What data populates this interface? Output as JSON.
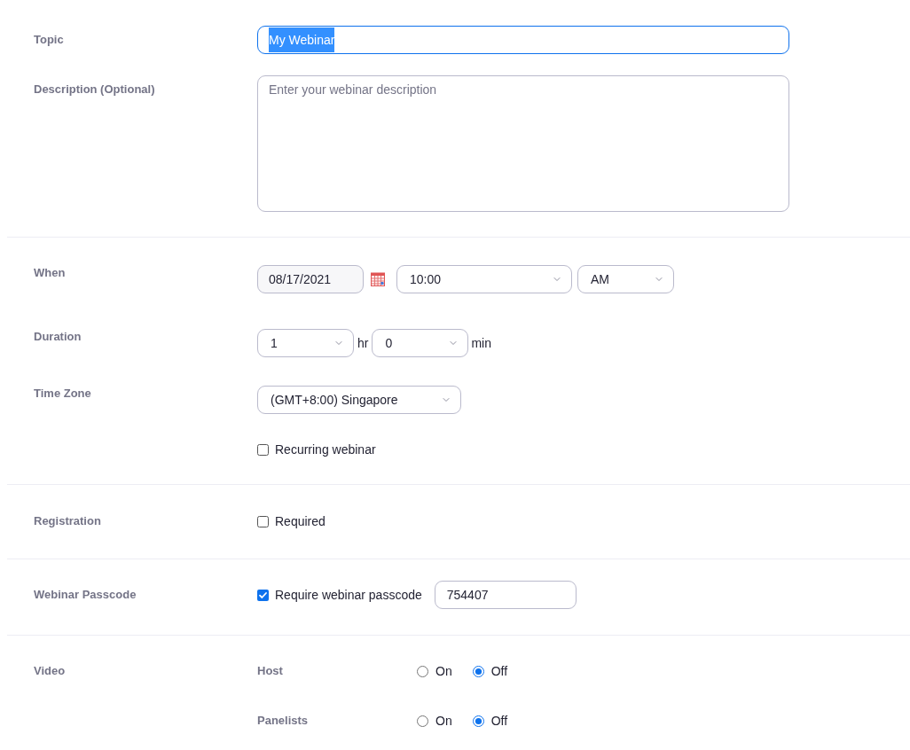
{
  "topic": {
    "label": "Topic",
    "value": "My Webinar",
    "focused": true,
    "text_selected": true
  },
  "description": {
    "label": "Description (Optional)",
    "placeholder": "Enter your webinar description"
  },
  "when": {
    "label": "When",
    "date": "08/17/2021",
    "time": "10:00",
    "period": "AM"
  },
  "duration": {
    "label": "Duration",
    "hours": "1",
    "hours_unit": "hr",
    "minutes": "0",
    "minutes_unit": "min"
  },
  "time_zone": {
    "label": "Time Zone",
    "value": "(GMT+8:00) Singapore"
  },
  "recurring": {
    "label": "Recurring webinar",
    "checked": false
  },
  "registration": {
    "label": "Registration",
    "option": {
      "label": "Required",
      "checked": false
    }
  },
  "passcode": {
    "label": "Webinar Passcode",
    "option": {
      "label": "Require webinar passcode",
      "checked": true
    },
    "value": "754407"
  },
  "video": {
    "label": "Video",
    "rows": [
      {
        "label": "Host",
        "options": [
          {
            "label": "On",
            "selected": false
          },
          {
            "label": "Off",
            "selected": true
          }
        ]
      },
      {
        "label": "Panelists",
        "options": [
          {
            "label": "On",
            "selected": false
          },
          {
            "label": "Off",
            "selected": true
          }
        ]
      }
    ]
  }
}
